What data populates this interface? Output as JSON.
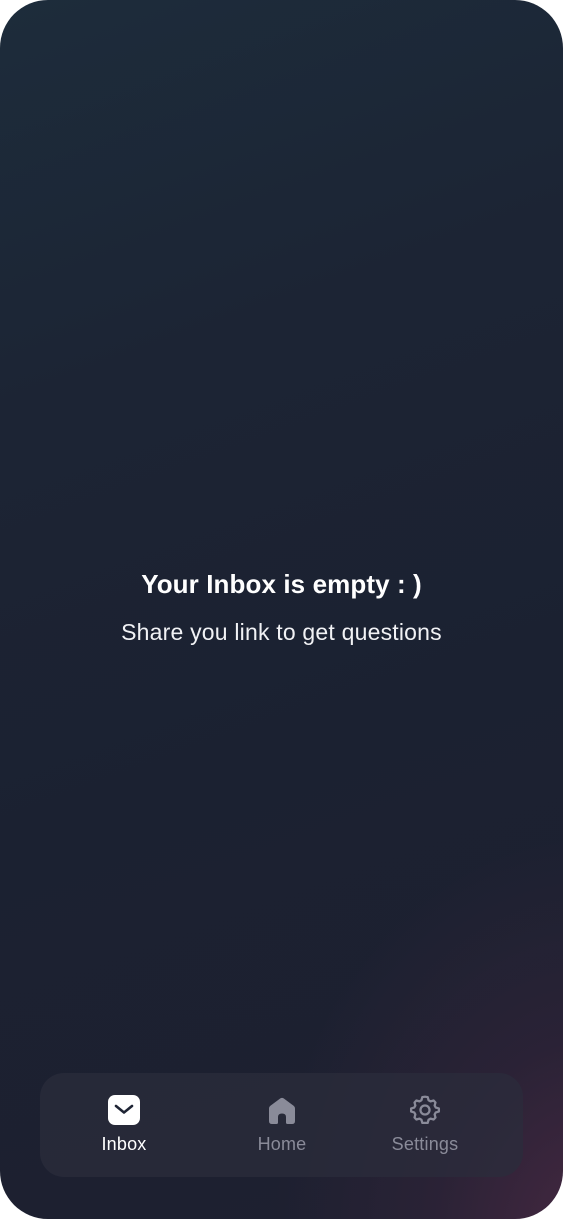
{
  "empty_state": {
    "title": "Your Inbox is empty : )",
    "subtitle": "Share you link to get questions"
  },
  "tabbar": {
    "active": "Inbox",
    "tabs": [
      {
        "label": "Inbox",
        "icon": "mail-icon",
        "active": true
      },
      {
        "label": "Home",
        "icon": "home-icon",
        "active": false
      },
      {
        "label": "Settings",
        "icon": "gear-icon",
        "active": false
      }
    ]
  },
  "colors": {
    "background_top": "#1d2c3b",
    "background_bottom_right": "#3a283e",
    "active_tab": "#ffffff",
    "inactive_tab": "#8a8b99"
  }
}
